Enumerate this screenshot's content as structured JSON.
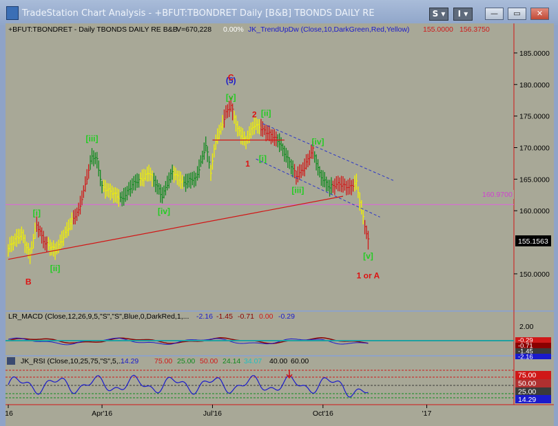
{
  "window": {
    "title": "TradeStation Chart Analysis - +BFUT:TBONDRET Daily [B&B] TBONDS DAILY RE",
    "btn_s": "S",
    "btn_i": "I",
    "btn_min": "—",
    "btn_max": "▭",
    "btn_close": "✕"
  },
  "header": {
    "symbol": "+BFUT:TBONDRET - Daily  TBONDS DAILY RE  B&B",
    "volume": "V=670,228",
    "pct": "0.00%",
    "indicator": "JK_TrendUpDw (Close,10,DarkGreen,Red,Yellow)",
    "val1": "155.0000",
    "val2": "156.3750"
  },
  "colors": {
    "background": "#a8a897",
    "up_bar": "#0f8a1e",
    "down_bar": "#d01818",
    "neutral_bar": "#f2f200",
    "magenta_line": "#e060e0",
    "trendline": "#d21414",
    "channel": "#2a35c8",
    "wave_green": "#22cc22",
    "wave_red": "#dd1111",
    "wave_blue": "#1a1acc"
  },
  "chart_data": {
    "type": "bar",
    "price_axis": {
      "ticks": [
        "185.0000",
        "180.0000",
        "175.0000",
        "170.0000",
        "165.0000",
        "160.0000",
        "150.0000"
      ],
      "ylim": [
        146.5,
        187.5
      ],
      "last_price": "155.1563",
      "level_label": "160.9700",
      "level_value": 160.97
    },
    "date_axis": [
      "'16",
      "Apr'16",
      "Jul'16",
      "Oct'16",
      "'17"
    ],
    "date_axis_index": [
      0,
      56,
      122,
      188,
      250
    ],
    "trend_segments": [
      {
        "from": 0,
        "to": 16,
        "color": "neutral"
      },
      {
        "from": 16,
        "to": 23,
        "color": "down"
      },
      {
        "from": 23,
        "to": 38,
        "color": "neutral"
      },
      {
        "from": 38,
        "to": 48,
        "color": "down"
      },
      {
        "from": 48,
        "to": 56,
        "color": "up"
      },
      {
        "from": 56,
        "to": 66,
        "color": "neutral"
      },
      {
        "from": 66,
        "to": 78,
        "color": "up"
      },
      {
        "from": 78,
        "to": 86,
        "color": "neutral"
      },
      {
        "from": 86,
        "to": 98,
        "color": "up"
      },
      {
        "from": 98,
        "to": 104,
        "color": "neutral"
      },
      {
        "from": 104,
        "to": 120,
        "color": "up"
      },
      {
        "from": 120,
        "to": 128,
        "color": "neutral"
      },
      {
        "from": 128,
        "to": 134,
        "color": "down"
      },
      {
        "from": 134,
        "to": 150,
        "color": "neutral"
      },
      {
        "from": 150,
        "to": 160,
        "color": "down"
      },
      {
        "from": 160,
        "to": 170,
        "color": "up"
      },
      {
        "from": 170,
        "to": 182,
        "color": "down"
      },
      {
        "from": 182,
        "to": 193,
        "color": "up"
      },
      {
        "from": 193,
        "to": 206,
        "color": "down"
      },
      {
        "from": 206,
        "to": 212,
        "color": "neutral"
      },
      {
        "from": 212,
        "to": 216,
        "color": "down"
      }
    ],
    "anchors": [
      {
        "i": 0,
        "p": 154.0
      },
      {
        "i": 8,
        "p": 156.5
      },
      {
        "i": 13,
        "p": 152.8
      },
      {
        "i": 17,
        "p": 157.8
      },
      {
        "i": 22,
        "p": 155.0
      },
      {
        "i": 28,
        "p": 153.5
      },
      {
        "i": 34,
        "p": 156.5
      },
      {
        "i": 42,
        "p": 160.0
      },
      {
        "i": 50,
        "p": 168.5
      },
      {
        "i": 53,
        "p": 168.0
      },
      {
        "i": 56,
        "p": 164.0
      },
      {
        "i": 63,
        "p": 162.5
      },
      {
        "i": 68,
        "p": 162.0
      },
      {
        "i": 76,
        "p": 164.5
      },
      {
        "i": 84,
        "p": 166.0
      },
      {
        "i": 92,
        "p": 162.5
      },
      {
        "i": 98,
        "p": 166.0
      },
      {
        "i": 105,
        "p": 164.5
      },
      {
        "i": 112,
        "p": 165.0
      },
      {
        "i": 118,
        "p": 170.5
      },
      {
        "i": 121,
        "p": 166.0
      },
      {
        "i": 124,
        "p": 171.0
      },
      {
        "i": 130,
        "p": 175.5
      },
      {
        "i": 133,
        "p": 176.5
      },
      {
        "i": 137,
        "p": 173.0
      },
      {
        "i": 142,
        "p": 171.0
      },
      {
        "i": 147,
        "p": 173.5
      },
      {
        "i": 150,
        "p": 173.5
      },
      {
        "i": 156,
        "p": 172.0
      },
      {
        "i": 162,
        "p": 171.0
      },
      {
        "i": 168,
        "p": 167.5
      },
      {
        "i": 172,
        "p": 165.5
      },
      {
        "i": 177,
        "p": 167.0
      },
      {
        "i": 182,
        "p": 169.5
      },
      {
        "i": 186,
        "p": 166.0
      },
      {
        "i": 192,
        "p": 163.5
      },
      {
        "i": 198,
        "p": 164.5
      },
      {
        "i": 204,
        "p": 163.5
      },
      {
        "i": 208,
        "p": 164.5
      },
      {
        "i": 212,
        "p": 159.0
      },
      {
        "i": 215,
        "p": 155.15
      }
    ],
    "waves": [
      {
        "label": "(5)",
        "i": 133,
        "p": 180.2,
        "color": "blue"
      },
      {
        "label": "C",
        "i": 133,
        "p": 180.7,
        "color": "red"
      },
      {
        "label": "[v]",
        "i": 133,
        "p": 177.5,
        "color": "green"
      },
      {
        "label": "2",
        "i": 147,
        "p": 174.8,
        "color": "red"
      },
      {
        "label": "[ii]",
        "i": 154,
        "p": 175.0,
        "color": "green"
      },
      {
        "label": "[iii]",
        "i": 50,
        "p": 171.0,
        "color": "green"
      },
      {
        "label": "[iv]",
        "i": 185,
        "p": 170.5,
        "color": "green"
      },
      {
        "label": "[i]",
        "i": 152,
        "p": 167.8,
        "color": "green"
      },
      {
        "label": "1",
        "i": 143,
        "p": 167.0,
        "color": "red"
      },
      {
        "label": "[iii]",
        "i": 173,
        "p": 162.8,
        "color": "green"
      },
      {
        "label": "[iv]",
        "i": 93,
        "p": 159.5,
        "color": "green"
      },
      {
        "label": "[i]",
        "i": 17,
        "p": 159.2,
        "color": "green"
      },
      {
        "label": "[ii]",
        "i": 28,
        "p": 150.4,
        "color": "green"
      },
      {
        "label": "B",
        "i": 12,
        "p": 148.3,
        "color": "red"
      },
      {
        "label": "[v]",
        "i": 215,
        "p": 152.4,
        "color": "green"
      },
      {
        "label": "1 or A",
        "i": 215,
        "p": 149.3,
        "color": "red"
      }
    ],
    "trendline": {
      "i1": 0,
      "p1": 152.3,
      "i2": 200,
      "p2": 162.3
    },
    "horizontal_segment": {
      "i1": 122,
      "i2": 165,
      "p": 171.2
    },
    "channel_upper": {
      "i1": 152,
      "p1": 173.8,
      "i2": 230,
      "p2": 164.8
    },
    "channel_lower": {
      "i1": 148,
      "p1": 168.2,
      "i2": 222,
      "p2": 159.0
    },
    "macd": {
      "header": "LR_MACD (Close,12,26,9,5,\"S\",\"S\",Blue,0,DarkRed,1,...",
      "values": [
        "-2.16",
        "-1.45",
        "-0.71",
        "0.00",
        "-0.29"
      ],
      "ticks": [
        "2.00"
      ],
      "right_labels": [
        "-0.29",
        "-0.71",
        "-1.45",
        "-2.16"
      ]
    },
    "rsi": {
      "header": "JK_RSI (Close,10,25,75,\"S\",5,...",
      "values": [
        "14.29",
        "75.00",
        "25.00",
        "50.00",
        "24.14",
        "34.07",
        "40.00",
        "60.00"
      ],
      "ticks": [
        "75.00",
        "50.00",
        "25.00"
      ],
      "last": "14.29"
    }
  }
}
